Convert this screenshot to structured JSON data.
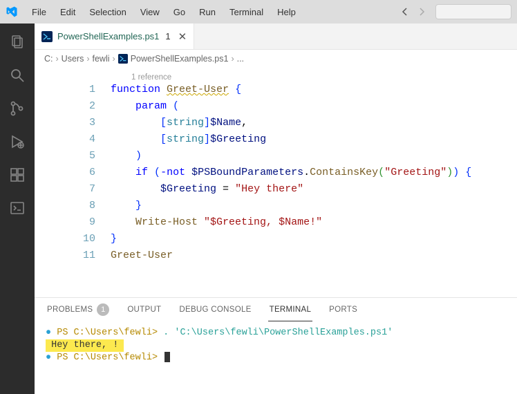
{
  "menu": {
    "items": [
      "File",
      "Edit",
      "Selection",
      "View",
      "Go",
      "Run",
      "Terminal",
      "Help"
    ]
  },
  "tab": {
    "filename": "PowerShellExamples.ps1",
    "dirty_indicator": "1"
  },
  "breadcrumbs": {
    "c": "C:",
    "users": "Users",
    "user": "fewli",
    "file": "PowerShellExamples.ps1",
    "ellipsis": "..."
  },
  "codelens": "1 reference",
  "line_numbers": [
    "1",
    "2",
    "3",
    "4",
    "5",
    "6",
    "7",
    "8",
    "9",
    "10",
    "11"
  ],
  "code": {
    "l1": {
      "function": "function",
      "fname": "Greet-User",
      "brace": "{"
    },
    "l2": {
      "param": "param",
      "paren": "("
    },
    "l3": {
      "lb": "[",
      "type": "string",
      "rb": "]",
      "var": "$Name",
      "comma": ","
    },
    "l4": {
      "lb": "[",
      "type": "string",
      "rb": "]",
      "var": "$Greeting"
    },
    "l5": {
      "paren": ")"
    },
    "l6": {
      "if": "if",
      "lp": "(",
      "not": "-not",
      "var": "$PSBoundParameters",
      "dot": ".",
      "method": "ContainsKey",
      "lp2": "(",
      "arg": "\"Greeting\"",
      "rp2": ")",
      "rp": ")",
      "brace": "{"
    },
    "l7": {
      "var": "$Greeting",
      "eq": "=",
      "str": "\"Hey there\""
    },
    "l8": {
      "brace": "}"
    },
    "l9": {
      "cmd": "Write-Host",
      "str": "\"$Greeting, $Name!\""
    },
    "l10": {
      "brace": "}"
    },
    "l11": {
      "call": "Greet-User"
    }
  },
  "panel": {
    "tabs": {
      "problems": "PROBLEMS",
      "problems_badge": "1",
      "output": "OUTPUT",
      "debug": "DEBUG CONSOLE",
      "terminal": "TERMINAL",
      "ports": "PORTS"
    },
    "terminal": {
      "line1_prompt": "PS C:\\Users\\fewli>",
      "line1_cmd": ". 'C:\\Users\\fewli\\PowerShellExamples.ps1'",
      "line2_out": " Hey there, ! ",
      "line3_prompt": "PS C:\\Users\\fewli>"
    }
  }
}
